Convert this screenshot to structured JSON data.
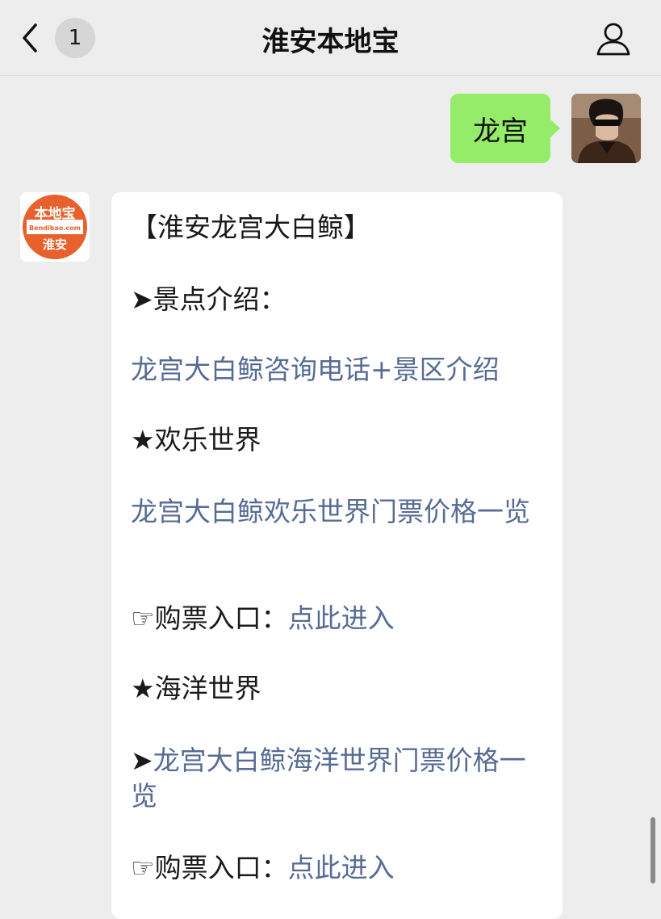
{
  "header": {
    "title": "淮安本地宝",
    "unread_count": "1"
  },
  "chat": {
    "sent_message": "龙宫",
    "account_avatar": {
      "top_text": "本地宝",
      "domain_text": "Bendibao.com",
      "city_text": "淮安",
      "accent_color": "#e8612c"
    },
    "reply": {
      "title": "【淮安龙宫大白鲸】",
      "section_intro": "➤景点介绍：",
      "intro_link": "龙宫大白鲸咨询电话+景区介绍",
      "section_fun": "★欢乐世界",
      "fun_link": "龙宫大白鲸欢乐世界门票价格一览",
      "ticket1_label": "☞购票入口：",
      "ticket1_link": "点此进入",
      "section_ocean": "★海洋世界",
      "ocean_prefix": "➤",
      "ocean_link": "龙宫大白鲸海洋世界门票价格一览",
      "ticket2_label": "☞购票入口：",
      "ticket2_link": "点此进入"
    }
  },
  "colors": {
    "background": "#ededed",
    "sent_bubble": "#95ec69",
    "link": "#576b95"
  },
  "icons": [
    "back-chevron-icon",
    "person-icon"
  ]
}
